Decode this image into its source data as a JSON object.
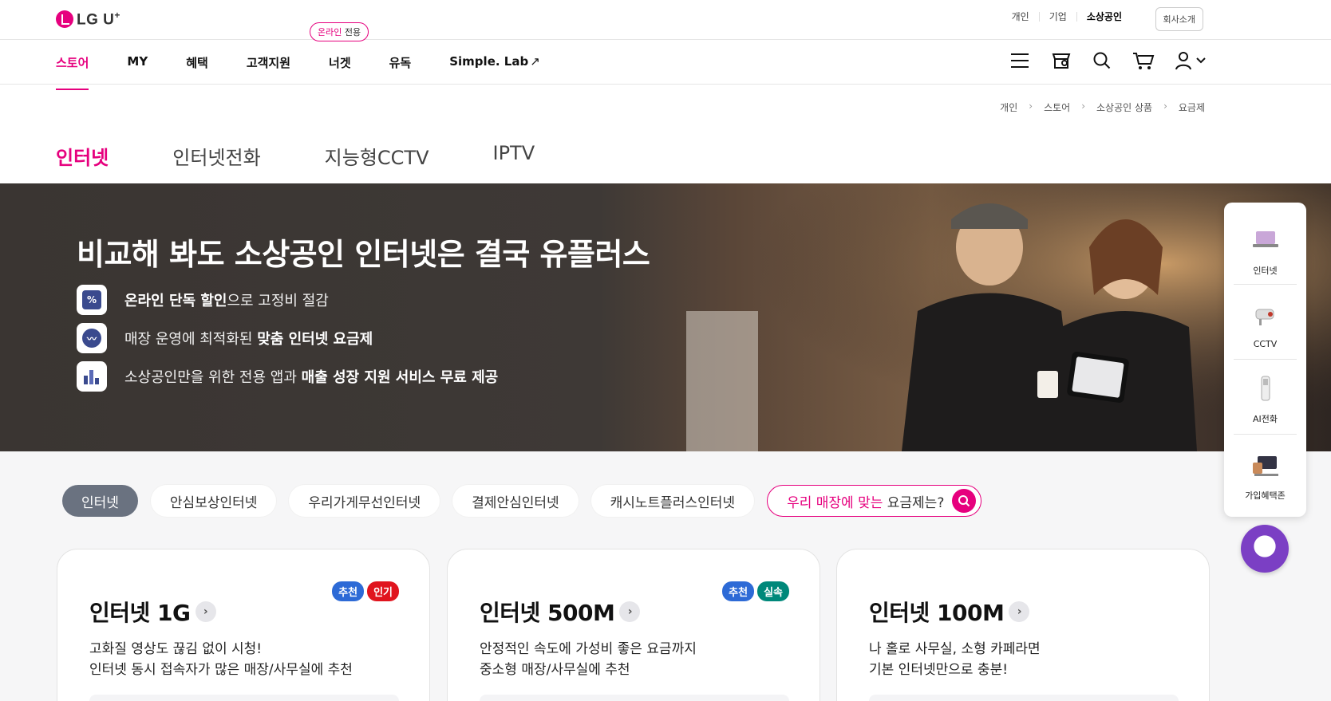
{
  "header": {
    "logo_text": "LG U",
    "logo_sup": "+",
    "util_links": [
      "개인",
      "기업",
      "소상공인"
    ],
    "company_button": "회사소개"
  },
  "gnb": {
    "items": [
      "스토어",
      "MY",
      "혜택",
      "고객지원",
      "너겟",
      "유독",
      "Simple. Lab"
    ],
    "online_badge_pink": "온라인",
    "online_badge_rest": " 전용"
  },
  "gnb_icons": [
    "menu-icon",
    "store-icon",
    "search-icon",
    "cart-icon",
    "user-icon"
  ],
  "breadcrumb": [
    "개인",
    "스토어",
    "소상공인 상품",
    "요금제"
  ],
  "tabs": [
    "인터넷",
    "인터넷전화",
    "지능형CCTV",
    "IPTV"
  ],
  "hero": {
    "title": "비교해 봐도 소상공인 인터넷은 결국 유플러스",
    "items": [
      {
        "bold": "온라인 단독 할인",
        "rest": "으로 고정비 절감"
      },
      {
        "pre": "매장 운영에 최적화된 ",
        "bold": "맞춤 인터넷 요금제"
      },
      {
        "pre": "소상공인만을 위한 전용 앱과 ",
        "bold": "매출 성장 지원 서비스 무료 제공"
      }
    ]
  },
  "quick_menu": [
    "인터넷",
    "CCTV",
    "AI전화",
    "가입혜택존"
  ],
  "chips": [
    "인터넷",
    "안심보상인터넷",
    "우리가게무선인터넷",
    "결제안심인터넷",
    "캐시노트플러스인터넷"
  ],
  "chip_special": {
    "pink": "우리 매장에 맞는",
    "rest": " 요금제는?"
  },
  "cards": [
    {
      "title": "인터넷 1G",
      "badges": [
        "추천",
        "인기"
      ],
      "desc1": "고화질 영상도 끊김 없이 시청!",
      "desc2": "인터넷 동시 접속자가 많은 매장/사무실에 추천"
    },
    {
      "title": "인터넷 500M",
      "badges": [
        "추천",
        "실속"
      ],
      "desc1": "안정적인 속도에 가성비 좋은 요금까지",
      "desc2": "중소형 매장/사무실에 추천"
    },
    {
      "title": "인터넷 100M",
      "badges": [],
      "desc1": "나 홀로 사무실, 소형 카페라면",
      "desc2": "기본 인터넷만으로 충분!"
    }
  ],
  "colors": {
    "brand": "#e6007e",
    "chip_active": "#6a7280",
    "badge_blue": "#2d6ad6",
    "badge_red": "#e0141e",
    "badge_teal": "#00887a"
  }
}
